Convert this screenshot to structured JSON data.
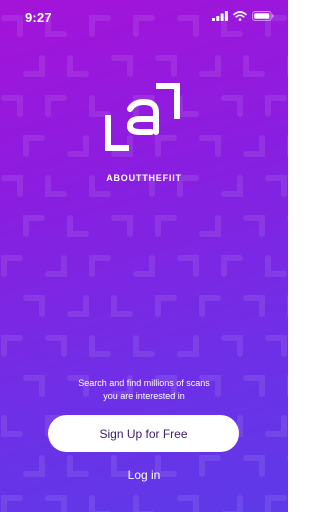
{
  "status_bar": {
    "time": "9:27",
    "icons": [
      "signal-icon",
      "wifi-icon",
      "battery-icon"
    ]
  },
  "brand": {
    "name": "ABOUTTHEFIIT",
    "logo_icon": "bracket-a-logo-icon"
  },
  "tagline": {
    "line1": "Search and find millions of scans",
    "line2": "you are interested in"
  },
  "actions": {
    "signup_label": "Sign Up for Free",
    "login_label": "Log in"
  },
  "colors": {
    "gradient_start": "#a413d8",
    "gradient_end": "#5d3ae8",
    "button_background": "#ffffff",
    "button_text": "#3d1a6b",
    "text": "#ffffff"
  }
}
